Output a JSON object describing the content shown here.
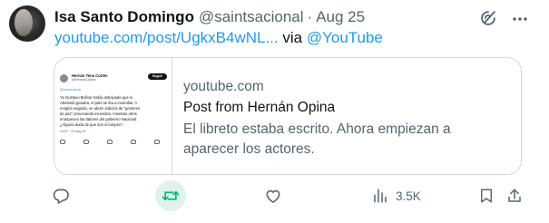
{
  "tweet": {
    "author_name": "Isa Santo Domingo",
    "author_handle": "@saintsacional",
    "separator": "·",
    "date": "Aug 25",
    "link_text": "youtube.com/post/UgkxB4wNL...",
    "via_text": "via",
    "via_handle": "@YouTube"
  },
  "card": {
    "domain": "youtube.com",
    "title": "Post from Hernán Opina",
    "description": "El libreto estaba escrito. Ahora empiezan a aparecer los actores.",
    "preview": {
      "author_name": "Hernán Tena Cortés",
      "author_handle": "@HernanOpina",
      "follow_label": "Seguir",
      "reply_to": "@lorenbolivar",
      "text": "Ya Gustavo Bolívar había anticipado que si\nAbelardo ganaba, el país se iba a incendiar. A\nrenglón seguido, se abren indicios de \"gestores\nde paz\" provocando incendios, mientras otros\nentorpecen las labores del gobierno Nacional.\n¿Alguna duda de que son el lumpen?",
      "meta": "14:07 · 24 Aug 25"
    }
  },
  "actions": {
    "views_count": "3.5K"
  },
  "colors": {
    "accent": "#1d9bf0",
    "retweet_active": "#00ba7c",
    "muted": "#536471",
    "border": "#cfd9de"
  },
  "icons": [
    "grok-icon",
    "more-icon",
    "reply-icon",
    "retweet-icon",
    "like-icon",
    "views-icon",
    "bookmark-icon",
    "share-icon"
  ]
}
